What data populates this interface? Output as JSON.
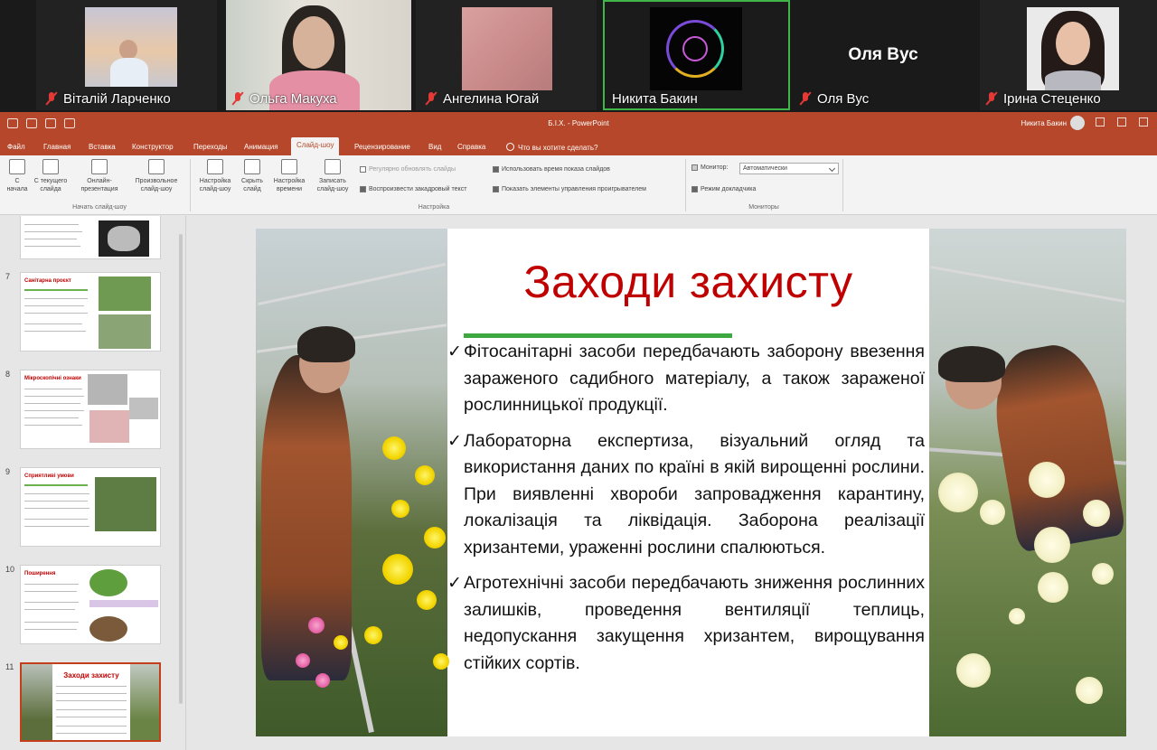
{
  "participants": [
    {
      "name": "Віталій Ларченко",
      "muted": true
    },
    {
      "name": "Ольга Макуха",
      "muted": true
    },
    {
      "name": "Ангелина Югай",
      "muted": true
    },
    {
      "name": "Никита Бакин",
      "muted": false,
      "active": true
    },
    {
      "name": "Оля Вус",
      "muted": true
    },
    {
      "name": "Ірина Стеценко",
      "muted": true
    }
  ],
  "colors": {
    "accent": "#b7472a",
    "title_red": "#c00000",
    "bar_green": "#3da83f",
    "active_border": "#3fb54a"
  },
  "window": {
    "title": "Б.І.Х. - PowerPoint",
    "user": "Никита Бакин"
  },
  "tabs": [
    "Файл",
    "Главная",
    "Вставка",
    "Конструктор",
    "Переходы",
    "Анимация",
    "Слайд-шоу",
    "Рецензирование",
    "Вид",
    "Справка"
  ],
  "tell_me": "Что вы хотите сделать?",
  "ribbon": {
    "start_group": {
      "label": "Начать слайд-шоу",
      "buttons": [
        "С начала",
        "С текущего слайда",
        "Онлайн-презентация",
        "Произвольное слайд-шоу"
      ]
    },
    "setup_group": {
      "label": "Настройка",
      "buttons": [
        "Настройка слайд-шоу",
        "Скрыть слайд",
        "Настройка времени",
        "Записать слайд-шоу"
      ],
      "checks": [
        {
          "label": "Регулярно обновлять слайды",
          "checked": false
        },
        {
          "label": "Воспроизвести закадровый текст",
          "checked": true
        },
        {
          "label": "Использовать время показа слайдов",
          "checked": true
        },
        {
          "label": "Показать элементы управления проигрывателем",
          "checked": true
        }
      ]
    },
    "monitors_group": {
      "label": "Мониторы",
      "monitor_label": "Монитор:",
      "monitor_value": "Автоматически",
      "presenter_view": "Режим докладчика"
    }
  },
  "thumbnails": [
    {
      "number": "7",
      "title": "Санітарна проєкт"
    },
    {
      "number": "8",
      "title": "Мікроскопічні ознаки"
    },
    {
      "number": "9",
      "title": "Сприятливі умови"
    },
    {
      "number": "10",
      "title": "Поширення"
    },
    {
      "number": "11",
      "title": "Заходи захисту",
      "selected": true
    }
  ],
  "slide": {
    "title": "Заходи захисту",
    "bullets": [
      "Фітосанітарні засоби передбачають заборону ввезення зараженого садибного матеріалу, а також зараженої рослинницької продукції.",
      "Лабораторна експертиза, візуальний огляд та використання даних по країні в якій вирощенні рослини. При виявленні хвороби запровадження карантину, локалізація та ліквідація. Заборона реалізації хризантеми, ураженні рослини спалюються.",
      "Агротехнічні засоби передбачають зниження рослинних залишків, проведення вентиляції теплиць, недопускання закущення хризантем, вирощування стійких сортів."
    ]
  }
}
